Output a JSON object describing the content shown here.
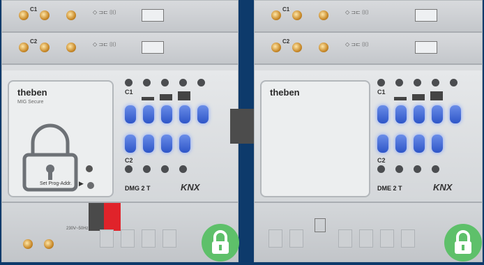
{
  "devices": [
    {
      "brand": "theben",
      "subtitle": "MIG Secure",
      "set_label": "Set Prog-Addr.",
      "model": "DMG 2 T",
      "knx": "KNX",
      "c1": "C1",
      "c2": "C2",
      "top_c1": "C1",
      "top_c2": "C2",
      "bottom_label": "230V~50Hz",
      "locked": true
    },
    {
      "brand": "theben",
      "model": "DME 2 T",
      "knx": "KNX",
      "c1": "C1",
      "c2": "C2",
      "top_c1": "C1",
      "top_c2": "C2",
      "locked": true
    }
  ],
  "colors": {
    "background": "#0d3a6b",
    "lock_badge": "#5ec06a",
    "button_blue": "#2e56c8",
    "connector_red": "#e0232a"
  }
}
